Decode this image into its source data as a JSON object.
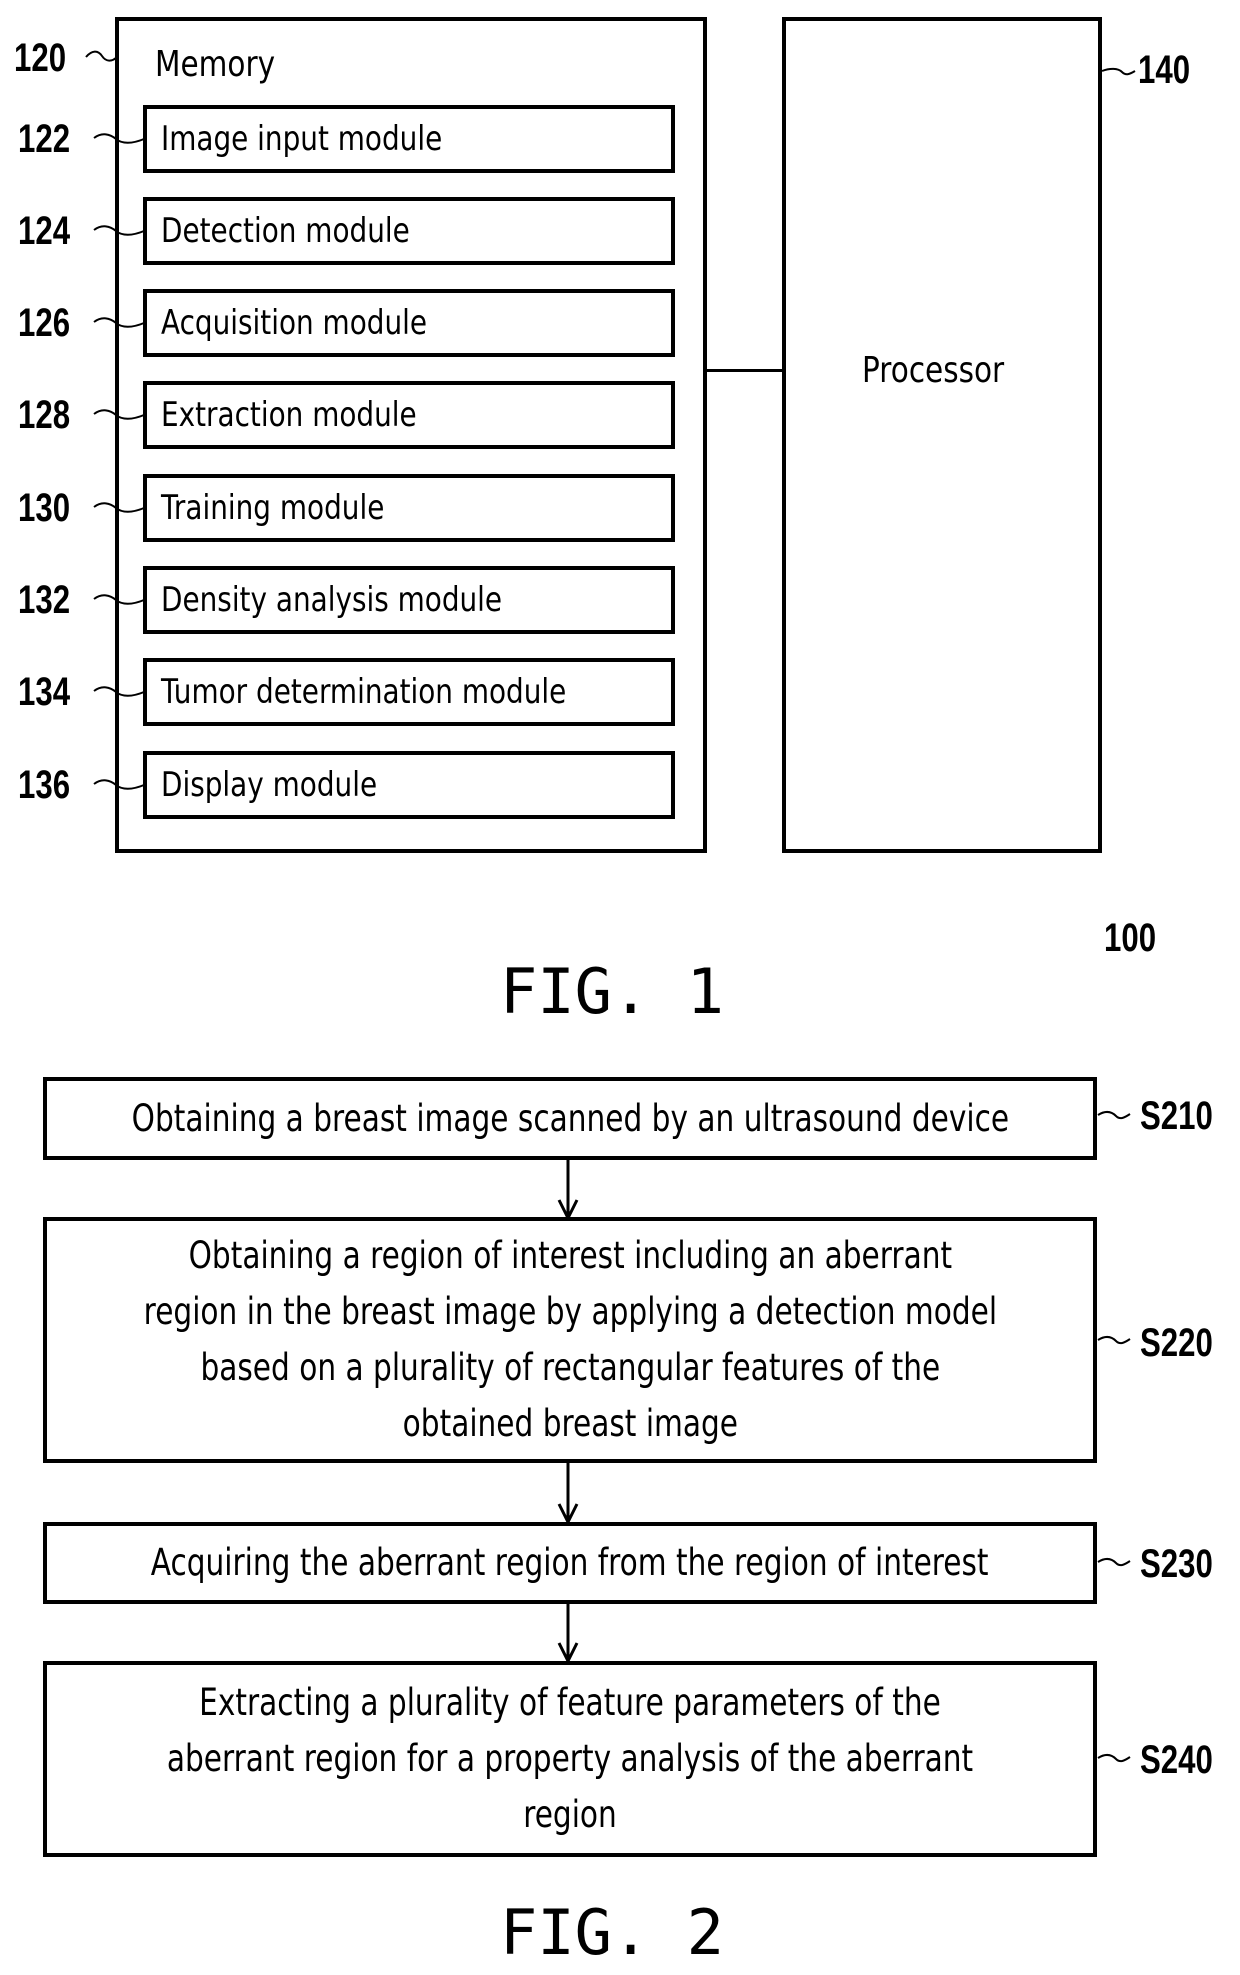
{
  "fig1": {
    "caption": "FIG. 1",
    "system_ref": "100",
    "memory": {
      "ref": "120",
      "label": "Memory",
      "modules": [
        {
          "ref": "122",
          "label": "Image input module"
        },
        {
          "ref": "124",
          "label": "Detection module"
        },
        {
          "ref": "126",
          "label": "Acquisition module"
        },
        {
          "ref": "128",
          "label": "Extraction module"
        },
        {
          "ref": "130",
          "label": "Training module"
        },
        {
          "ref": "132",
          "label": "Density analysis module"
        },
        {
          "ref": "134",
          "label": "Tumor determination module"
        },
        {
          "ref": "136",
          "label": "Display module"
        }
      ]
    },
    "processor": {
      "ref": "140",
      "label": "Processor"
    }
  },
  "fig2": {
    "caption": "FIG. 2",
    "steps": [
      {
        "ref": "S210",
        "lines": [
          "Obtaining a breast image scanned by an ultrasound device"
        ]
      },
      {
        "ref": "S220",
        "lines": [
          "Obtaining a region of interest including an aberrant",
          "region in the breast image by applying a detection model",
          "based on a plurality of rectangular features of the",
          "obtained breast image"
        ]
      },
      {
        "ref": "S230",
        "lines": [
          "Acquiring the aberrant region from the region of interest"
        ]
      },
      {
        "ref": "S240",
        "lines": [
          "Extracting a plurality of feature parameters of the",
          "aberrant region for a property analysis of the aberrant",
          "region"
        ]
      }
    ]
  }
}
